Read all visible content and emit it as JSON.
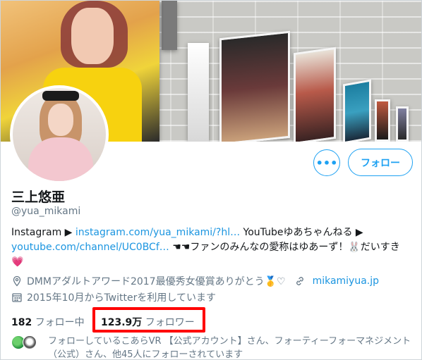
{
  "profile": {
    "name": "三上悠亜",
    "handle": "@yua_mikami",
    "bio": {
      "prefix": "Instagram ▶ ",
      "instagram_link": "instagram.com/yua_mikami/?hl…",
      "middle": " YouTubeゆあちゃんねる ▶ ",
      "youtube_link": "youtube.com/channel/UC0BCf…",
      "suffix": " ☚☚ファンのみんなの愛称はゆあーず！🐰だいすき",
      "heart": "💗"
    },
    "location": "DMMアダルトアワード2017最優秀女優賞ありがとう🥇♡",
    "website": "mikamiyua.jp",
    "joined": "2015年10月からTwitterを利用しています"
  },
  "buttons": {
    "more": "•••",
    "follow": "フォロー"
  },
  "stats": {
    "following_count": "182",
    "following_label": "フォロー中",
    "followers_count": "123.9万",
    "followers_label": "フォロワー"
  },
  "followed_by": "フォローしているこあらVR 【公式アカウント】さん、フォーティーフォーマネジメント（公式）さん、他45人にフォローされています",
  "icons": {
    "location": "location-pin-icon",
    "website": "link-icon",
    "joined": "calendar-icon"
  },
  "colors": {
    "accent": "#1da1f2",
    "link": "#1b95e0",
    "highlight_box": "#ff0000"
  }
}
